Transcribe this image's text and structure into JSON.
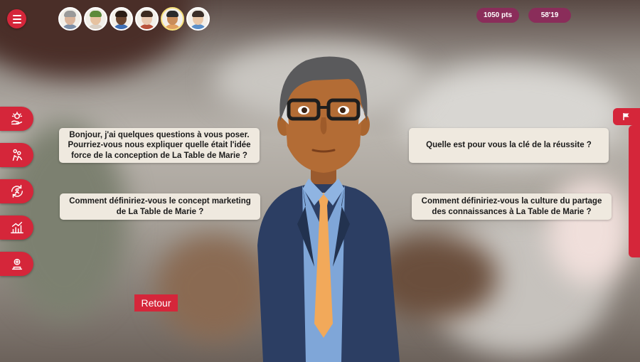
{
  "header": {
    "menu_icon": "hamburger-menu-icon",
    "avatars": [
      {
        "name": "avatar-character-1",
        "skin": "#d9b49b",
        "hair": "#9a9a9a",
        "shirt": "#7d8fa8"
      },
      {
        "name": "avatar-character-2",
        "skin": "#e6c2a0",
        "hair": "#5c8a3a",
        "shirt": "#d8cfc4"
      },
      {
        "name": "avatar-character-3",
        "skin": "#6b4630",
        "hair": "#2a1c14",
        "shirt": "#3f6fb4"
      },
      {
        "name": "avatar-character-4",
        "skin": "#e9c9b0",
        "hair": "#3c2a20",
        "shirt": "#b8523c"
      },
      {
        "name": "avatar-character-5",
        "skin": "#c98d5a",
        "hair": "#2a2a2a",
        "shirt": "#e0a060"
      },
      {
        "name": "avatar-character-6",
        "skin": "#e8c6a6",
        "hair": "#3a2e28",
        "shirt": "#5a8fc8"
      }
    ],
    "points": "1050 pts",
    "timer": "58'19"
  },
  "side_tools": [
    {
      "name": "lightbulb-hand-icon"
    },
    {
      "name": "team-people-icon"
    },
    {
      "name": "refresh-people-icon"
    },
    {
      "name": "trophy-chart-icon"
    },
    {
      "name": "award-ribbon-icon"
    }
  ],
  "right_panel": {
    "icon": "flag-icon"
  },
  "questions": {
    "q1": "Bonjour, j'ai quelques questions à vous poser. Pourriez-vous nous expliquer quelle était l'idée force de la conception de La Table de Marie ?",
    "q2": "Quelle est pour vous la clé de la réussite ?",
    "q3": "Comment définiriez-vous le concept marketing de La Table de Marie ?",
    "q4": "Comment définiriez-vous la culture du partage des connaissances à La Table de Marie ?"
  },
  "retour_label": "Retour",
  "colors": {
    "accent": "#d5263a",
    "pill": "#8a2d5a",
    "bubble": "#efe9df"
  }
}
